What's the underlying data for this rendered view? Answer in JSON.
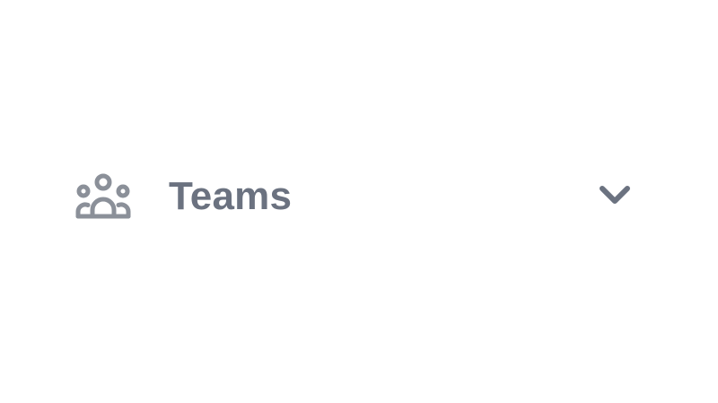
{
  "nav": {
    "item": {
      "label": "Teams",
      "icon": "users-group-icon",
      "expand_icon": "chevron-down-icon",
      "expanded": false
    }
  },
  "colors": {
    "text": "#6b7280",
    "icon": "#8b9099",
    "background": "#ffffff"
  }
}
